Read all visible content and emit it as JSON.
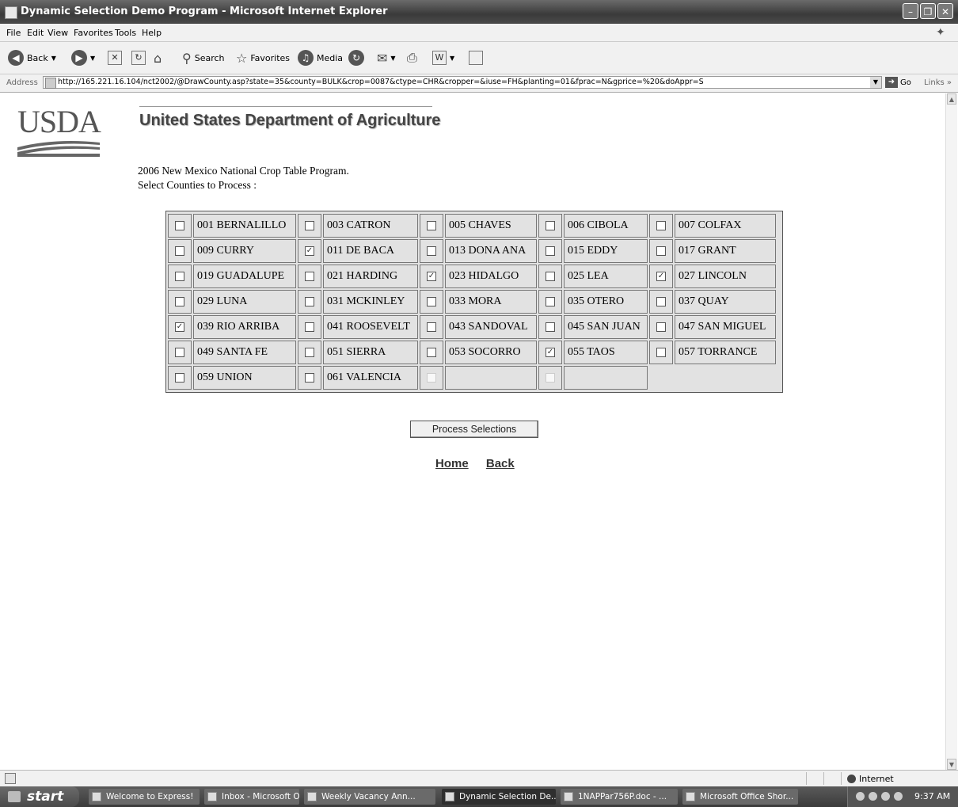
{
  "window": {
    "title": "Dynamic Selection Demo Program - Microsoft Internet Explorer"
  },
  "menu": [
    "File",
    "Edit",
    "View",
    "Favorites",
    "Tools",
    "Help"
  ],
  "toolbar": {
    "back": "Back",
    "search": "Search",
    "favorites": "Favorites",
    "media": "Media"
  },
  "address": {
    "label": "Address",
    "url": "http://165.221.16.104/nct2002/@DrawCounty.asp?state=35&county=BULK&crop=0087&ctype=CHR&cropper=&iuse=FH&planting=01&fprac=N&gprice=%20&doAppr=S",
    "go": "Go",
    "links": "Links"
  },
  "page": {
    "logo": "USDA",
    "dept_title": "United States Department of Agriculture",
    "program_title": "2006 New Mexico National Crop Table Program.",
    "select_label": "Select Counties to Process :",
    "process_button": "Process Selections",
    "links": {
      "home": "Home",
      "back": "Back"
    }
  },
  "counties": [
    [
      {
        "name": "001 BERNALILLO",
        "checked": false
      },
      {
        "name": "003 CATRON",
        "checked": false
      },
      {
        "name": "005 CHAVES",
        "checked": false
      },
      {
        "name": "006 CIBOLA",
        "checked": false
      },
      {
        "name": "007 COLFAX",
        "checked": false
      }
    ],
    [
      {
        "name": "009 CURRY",
        "checked": false
      },
      {
        "name": "011 DE BACA",
        "checked": true
      },
      {
        "name": "013 DONA ANA",
        "checked": false
      },
      {
        "name": "015 EDDY",
        "checked": false
      },
      {
        "name": "017 GRANT",
        "checked": false
      }
    ],
    [
      {
        "name": "019 GUADALUPE",
        "checked": false
      },
      {
        "name": "021 HARDING",
        "checked": false
      },
      {
        "name": "023 HIDALGO",
        "checked": true
      },
      {
        "name": "025 LEA",
        "checked": false
      },
      {
        "name": "027 LINCOLN",
        "checked": true
      }
    ],
    [
      {
        "name": "029 LUNA",
        "checked": false
      },
      {
        "name": "031 MCKINLEY",
        "checked": false
      },
      {
        "name": "033 MORA",
        "checked": false
      },
      {
        "name": "035 OTERO",
        "checked": false
      },
      {
        "name": "037 QUAY",
        "checked": false
      }
    ],
    [
      {
        "name": "039 RIO ARRIBA",
        "checked": true
      },
      {
        "name": "041 ROOSEVELT",
        "checked": false
      },
      {
        "name": "043 SANDOVAL",
        "checked": false
      },
      {
        "name": "045 SAN JUAN",
        "checked": false
      },
      {
        "name": "047 SAN MIGUEL",
        "checked": false
      }
    ],
    [
      {
        "name": "049 SANTA FE",
        "checked": false
      },
      {
        "name": "051 SIERRA",
        "checked": false
      },
      {
        "name": "053 SOCORRO",
        "checked": false
      },
      {
        "name": "055 TAOS",
        "checked": true
      },
      {
        "name": "057 TORRANCE",
        "checked": false
      }
    ],
    [
      {
        "name": "059 UNION",
        "checked": false
      },
      {
        "name": "061 VALENCIA",
        "checked": false
      },
      {
        "name": "",
        "checked": false,
        "disabled": true
      },
      {
        "name": "",
        "checked": false,
        "disabled": true
      }
    ]
  ],
  "status": {
    "zone": "Internet"
  },
  "taskbar": {
    "start": "start",
    "tasks": [
      {
        "label": "Welcome to Express!",
        "active": false
      },
      {
        "label": "Inbox - Microsoft Out...",
        "active": false
      },
      {
        "label": "Weekly Vacancy Ann...",
        "active": false
      },
      {
        "label": "Dynamic Selection De...",
        "active": true
      },
      {
        "label": "1NAPPar756P.doc - ...",
        "active": false
      },
      {
        "label": "Microsoft Office Shor...",
        "active": false
      }
    ],
    "clock": "9:37 AM"
  }
}
